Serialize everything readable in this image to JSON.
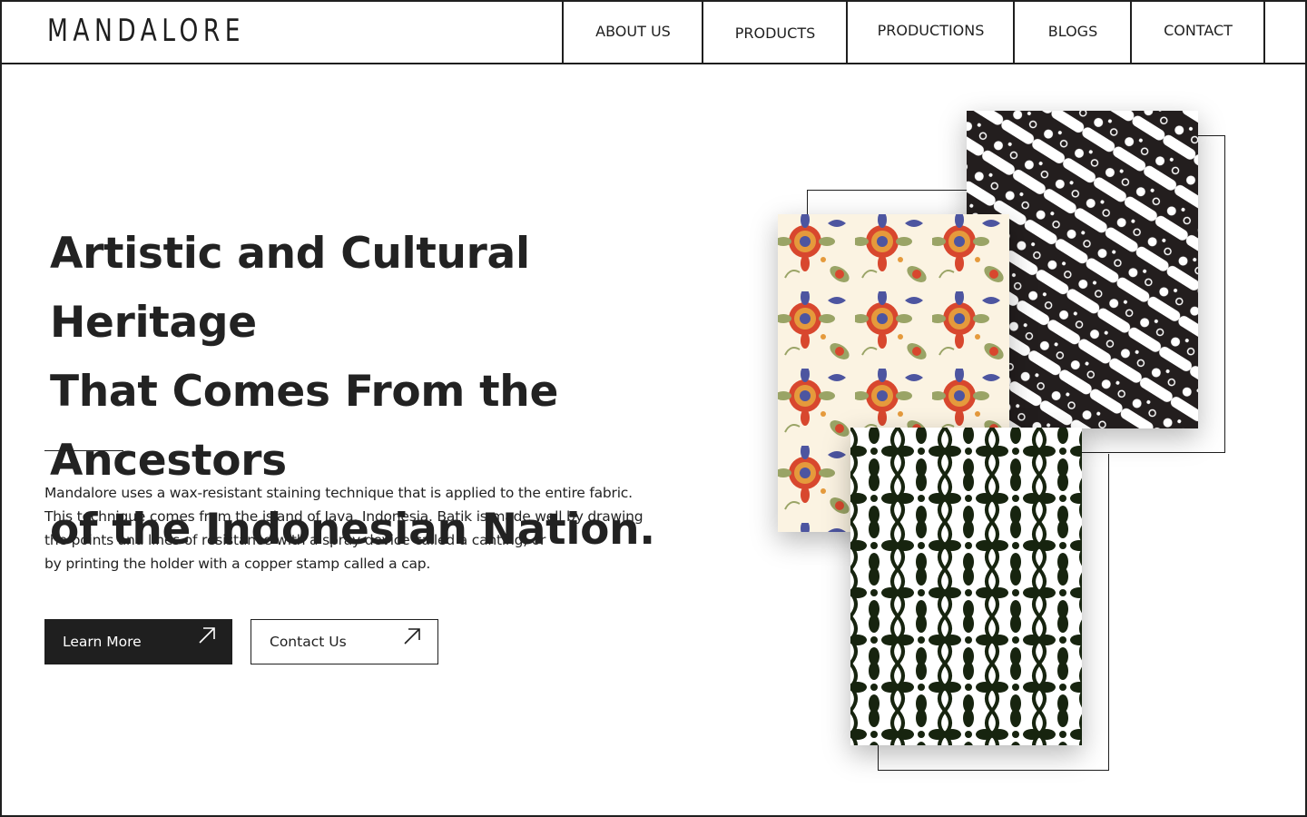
{
  "brand": {
    "logo": "MANDALORE"
  },
  "nav": {
    "items": [
      {
        "label": "ABOUT US"
      },
      {
        "label": "PRODUCTS"
      },
      {
        "label": "PRODUCTIONS"
      },
      {
        "label": "BLOGS"
      },
      {
        "label": "CONTACT"
      }
    ]
  },
  "hero": {
    "headline_lines": [
      "Artistic and Cultural Heritage",
      "That Comes From the Ancestors",
      "of the Indonesian Nation."
    ],
    "description_lines": [
      "Mandalore uses a wax-resistant staining technique that is applied to the entire fabric.",
      "This technique comes from the island of Java, Indonesia. Batik is made well by drawing",
      "the points and lines of resistance with a spray device called a canting, or",
      "by printing the holder with a copper stamp called a cap."
    ],
    "buttons": {
      "primary": "Learn More",
      "secondary": "Contact Us"
    }
  },
  "gallery": {
    "cards": [
      {
        "name": "parang-batik",
        "colors": [
          "#231e1e",
          "#ffffff"
        ]
      },
      {
        "name": "floral-batik",
        "colors": [
          "#fbf3e2",
          "#d8472e",
          "#4d55a0",
          "#9aa466",
          "#e59a3c"
        ]
      },
      {
        "name": "kawung-batik",
        "colors": [
          "#ffffff",
          "#17240f"
        ]
      }
    ]
  },
  "colors": {
    "ink": "#1f1f1f",
    "background": "#ffffff"
  }
}
